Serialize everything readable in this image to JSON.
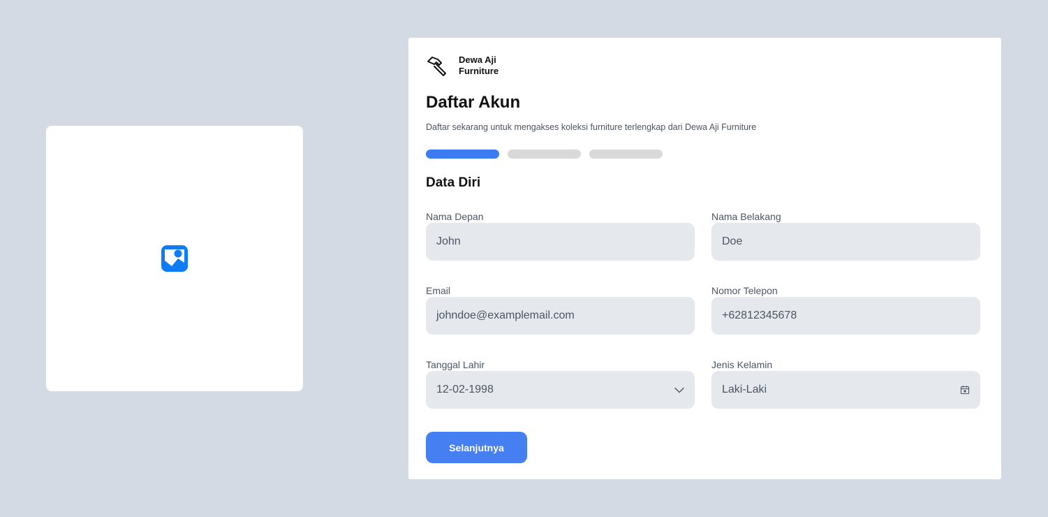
{
  "image_panel": {
    "icon": "image-icon",
    "accent": "#0f7bf5"
  },
  "brand": {
    "icon": "hammer-icon",
    "name_line1": "Dewa Aji",
    "name_line2": "Furniture"
  },
  "page": {
    "title": "Daftar Akun",
    "subtitle": "Daftar sekarang untuk mengakses koleksi furniture terlengkap dari Dewa Aji Furniture"
  },
  "steps": {
    "total": 3,
    "current": 1,
    "active_color": "#3b7cf0",
    "inactive_color": "#d9d9d9"
  },
  "section": {
    "title": "Data Diri"
  },
  "fields": {
    "first_name": {
      "label": "Nama Depan",
      "value": "John"
    },
    "last_name": {
      "label": "Nama Belakang",
      "value": "Doe"
    },
    "email": {
      "label": "Email",
      "value": "johndoe@examplemail.com"
    },
    "phone": {
      "label": "Nomor Telepon",
      "value": "+62812345678"
    },
    "birth_date": {
      "label": "Tanggal Lahir",
      "value": "12-02-1998",
      "icon": "chevron-down-icon"
    },
    "gender": {
      "label": "Jenis Kelamin",
      "value": "Laki-Laki",
      "icon": "calendar-icon"
    }
  },
  "actions": {
    "next_label": "Selanjutnya",
    "button_color": "#467ff2"
  }
}
